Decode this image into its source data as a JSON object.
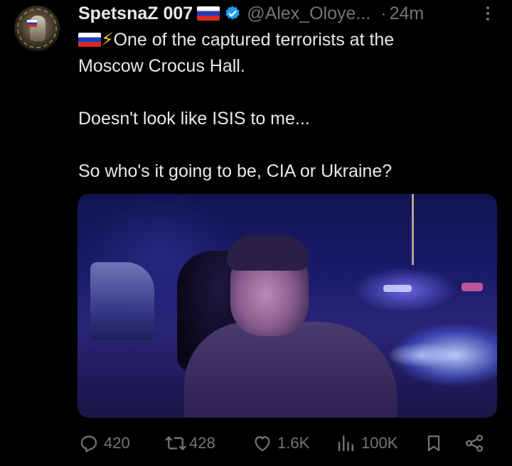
{
  "tweet": {
    "author_name": "SpetsnaZ 007",
    "handle": "@Alex_Oloye...",
    "separator": "·",
    "time": "24m",
    "text_line1": "One of the captured terrorists at the",
    "text_line2": "Moscow Crocus Hall.",
    "text_line3": "Doesn't look like ISIS to me...",
    "text_line4": "So who's it going to be, CIA or Ukraine?",
    "bolt": "⚡"
  },
  "icons": {
    "avatar": "avatar-image",
    "flag": "russia-flag-icon",
    "verified": "verified-badge-icon",
    "more": "more-options-icon",
    "reply": "reply-icon",
    "repost": "repost-icon",
    "like": "like-icon",
    "views": "views-icon",
    "bookmark": "bookmark-icon",
    "share": "share-icon"
  },
  "actions": {
    "replies": "420",
    "reposts": "428",
    "likes": "1.6K",
    "views": "100K"
  },
  "colors": {
    "background": "#000000",
    "text": "#e7e9ea",
    "muted": "#71767b",
    "verified": "#1d9bf0"
  }
}
